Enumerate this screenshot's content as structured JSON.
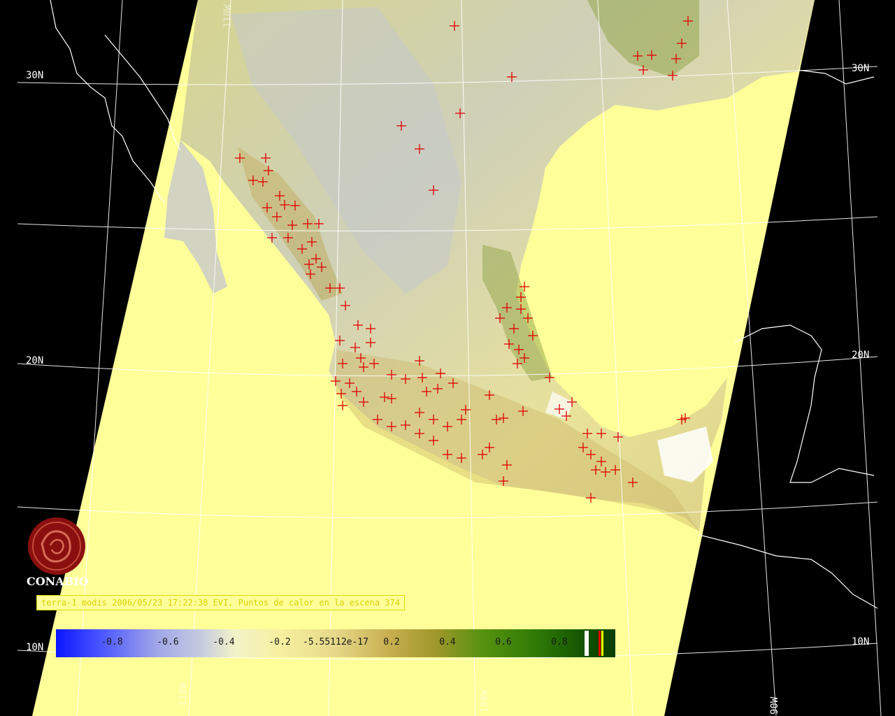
{
  "title": "terra-1 modis 2006/05/23 17:22:38 EVI, Puntos de calor en la escena 374",
  "logo_text": "CONABIO",
  "lat_labels": [
    "30N",
    "20N",
    "10N"
  ],
  "lon_labels": [
    "110W",
    "100W",
    "90W"
  ],
  "colorbar_ticks": [
    "-0.8",
    "-0.6",
    "-0.4",
    "-0.2",
    "-5.55112e-17",
    "0.2",
    "0.4",
    "0.6",
    "0.8"
  ],
  "colors": {
    "background": "#000000",
    "swath": "#ffff9a",
    "hotspot": "#e00000",
    "grid": "#ffffff"
  }
}
